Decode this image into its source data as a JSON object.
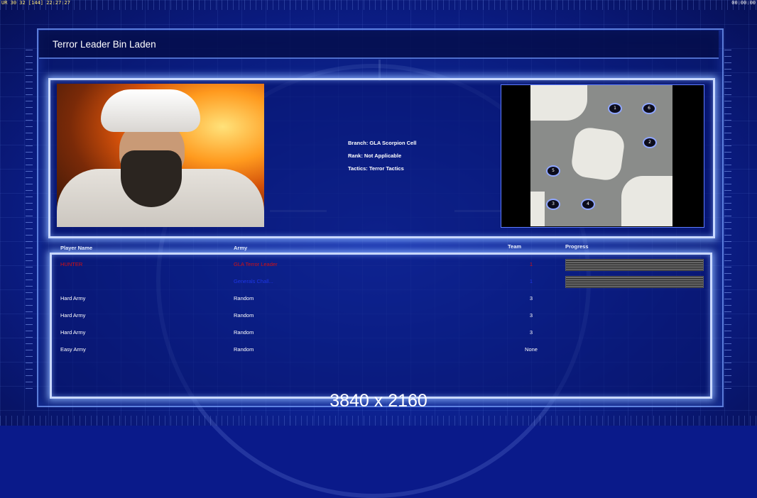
{
  "hud": {
    "stats": "UR 30 32 [144] 22:27:27",
    "clock": "00:00:00"
  },
  "header": {
    "title": "Terror Leader Bin Laden"
  },
  "briefing": {
    "branch": "Branch: GLA Scorpion Cell",
    "rank": "Rank: Not Applicable",
    "tactics": "Tactics: Terror Tactics"
  },
  "map": {
    "start_positions": [
      "1",
      "6",
      "2",
      "5",
      "3",
      "4"
    ]
  },
  "table": {
    "headers": {
      "player": "Player Name",
      "army": "Army",
      "team": "Team",
      "progress": "Progress"
    },
    "rows": [
      {
        "player": "HUNTER",
        "army": "GLA Terror Leader",
        "team": "1",
        "color": "#d80f0f",
        "progress": 1.0
      },
      {
        "player": "",
        "army": "Generals Chall...",
        "team": "1",
        "color": "#1e36e6",
        "progress": 1.0
      },
      {
        "player": "Hard Army",
        "army": "Random",
        "team": "3",
        "color": "#ffffff"
      },
      {
        "player": "Hard Army",
        "army": "Random",
        "team": "3",
        "color": "#ffffff"
      },
      {
        "player": "Hard Army",
        "army": "Random",
        "team": "3",
        "color": "#ffffff"
      },
      {
        "player": "Easy Army",
        "army": "Random",
        "team": "None",
        "color": "#ffffff"
      }
    ]
  },
  "watermark": "3840 x 2160"
}
